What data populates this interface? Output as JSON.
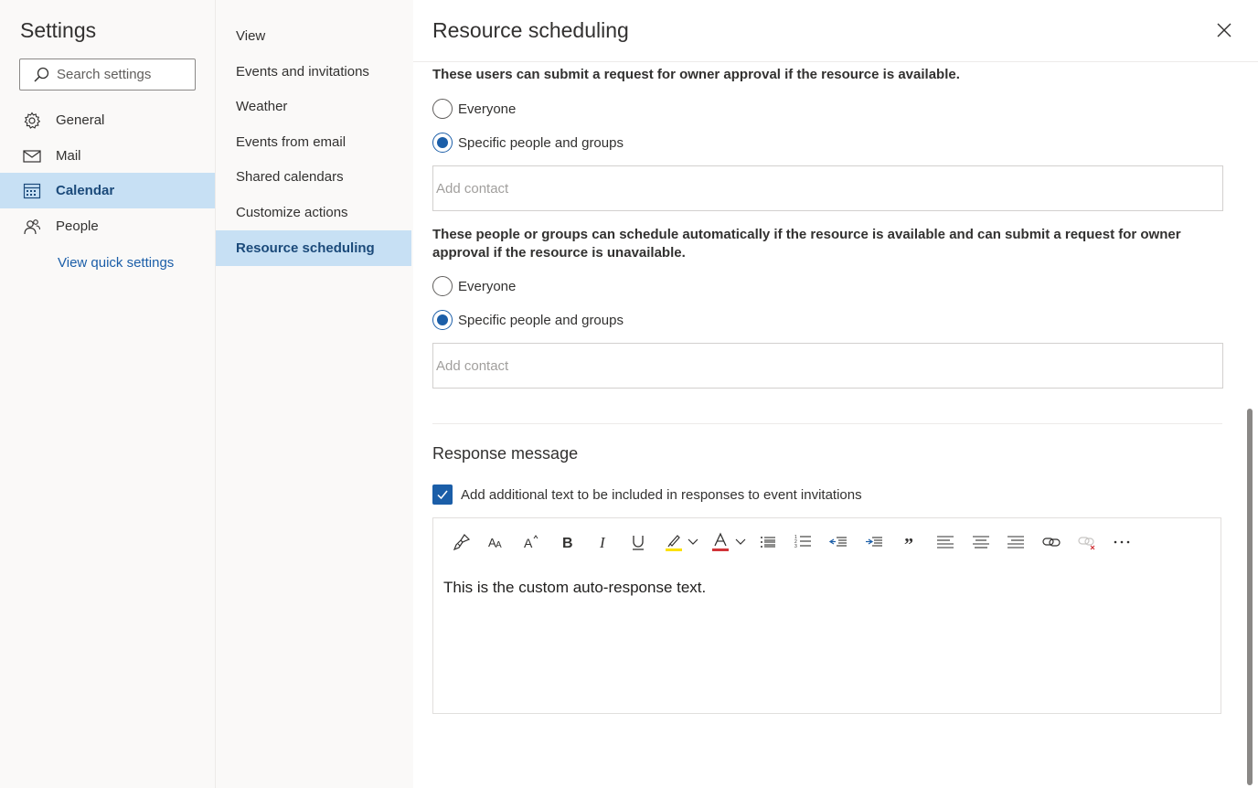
{
  "settings": {
    "title": "Settings",
    "search_placeholder": "Search settings",
    "nav": [
      {
        "label": "General",
        "icon": "gear-icon"
      },
      {
        "label": "Mail",
        "icon": "mail-icon"
      },
      {
        "label": "Calendar",
        "icon": "calendar-icon",
        "active": true
      },
      {
        "label": "People",
        "icon": "people-icon"
      }
    ],
    "quick_settings": "View quick settings"
  },
  "submenu": {
    "items": [
      "View",
      "Events and invitations",
      "Weather",
      "Events from email",
      "Shared calendars",
      "Customize actions",
      "Resource scheduling"
    ],
    "active": "Resource scheduling"
  },
  "main": {
    "title": "Resource scheduling",
    "group1": {
      "description": "These users can submit a request for owner approval if the resource is available.",
      "options": [
        "Everyone",
        "Specific people and groups"
      ],
      "selected": "Specific people and groups",
      "contact_placeholder": "Add contact"
    },
    "group2": {
      "description": "These people or groups can schedule automatically if the resource is available and can submit a request for owner approval if the resource is unavailable.",
      "options": [
        "Everyone",
        "Specific people and groups"
      ],
      "selected": "Specific people and groups",
      "contact_placeholder": "Add contact"
    },
    "response": {
      "title": "Response message",
      "checkbox_label": "Add additional text to be included in responses to event invitations",
      "checked": true,
      "editor_text": "This is the custom auto-response text.",
      "toolbar": [
        "format-painter-icon",
        "font-icon",
        "font-size-icon",
        "bold-icon",
        "italic-icon",
        "underline-icon",
        "highlight-icon",
        "font-color-icon",
        "bullets-icon",
        "numbering-icon",
        "decrease-indent-icon",
        "increase-indent-icon",
        "quote-icon",
        "align-left-icon",
        "align-center-icon",
        "align-right-icon",
        "link-icon",
        "unlink-icon",
        "more-icon"
      ]
    }
  },
  "colors": {
    "accent": "#1b5ea8",
    "selected_bg": "#c7e0f4",
    "pane_bg": "#faf9f8"
  }
}
